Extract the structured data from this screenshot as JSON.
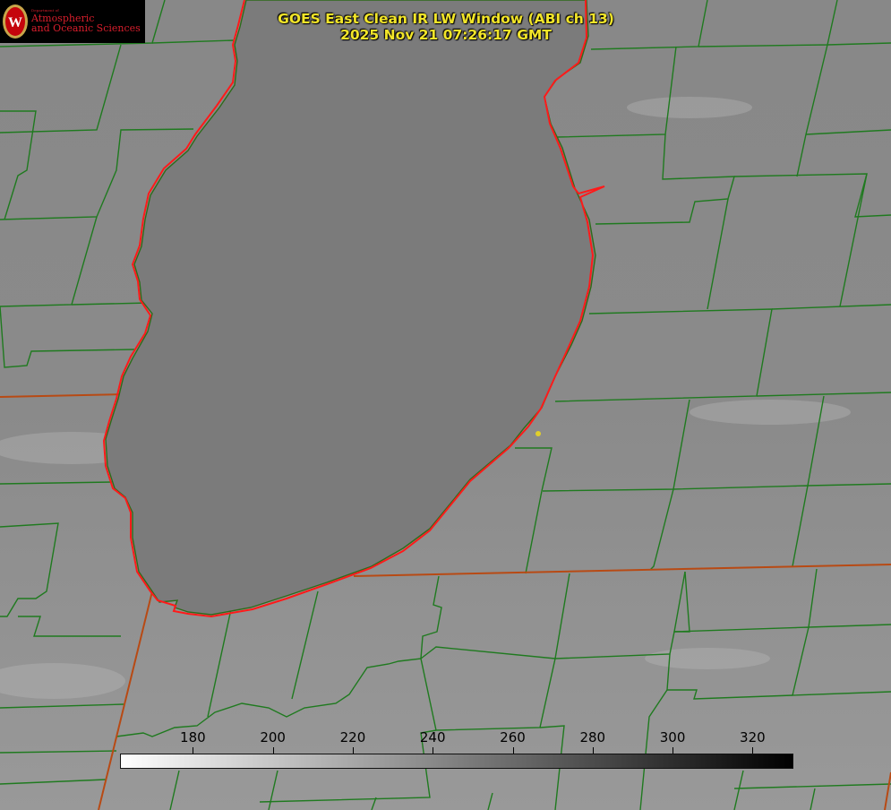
{
  "header": {
    "title": "GOES East Clean IR LW Window (ABI ch 13)",
    "timestamp": "2025 Nov 21 07:26:17 GMT"
  },
  "logo": {
    "department": "Department of",
    "line1": "Atmospheric",
    "line2": "and Oceanic Sciences",
    "seal_letter": "W"
  },
  "colorbar": {
    "ticks": [
      "180",
      "200",
      "220",
      "240",
      "260",
      "280",
      "300",
      "320"
    ],
    "range": [
      162,
      330
    ],
    "colormap": "white-to-black (warm is dark)",
    "start_color": "#ffffff",
    "end_color": "#000000"
  },
  "colors": {
    "county_lines": "#1f7a1f",
    "state_lines": "#b84a14",
    "lake_shoreline": "#ff1a1a",
    "station_marker": "#e1cf2a",
    "title_text": "#f2e529",
    "background": "#8a8a8a",
    "lake_fill": "#7b7b7b"
  }
}
